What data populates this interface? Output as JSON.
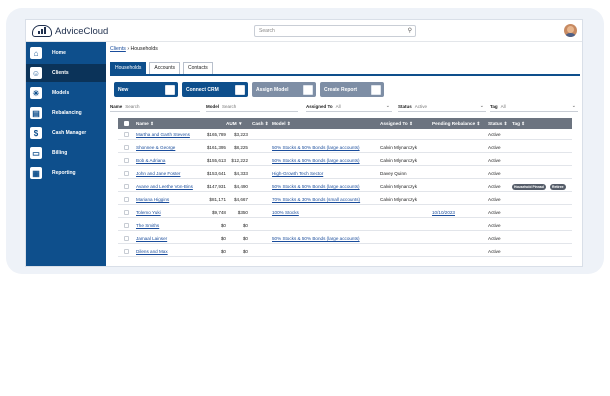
{
  "app": {
    "logo_text": "AdviceCloud"
  },
  "search": {
    "placeholder": "Search"
  },
  "sidebar": {
    "items": [
      {
        "label": "Home",
        "icon": "home-icon",
        "glyph": "⌂",
        "active": false
      },
      {
        "label": "Clients",
        "icon": "user-icon",
        "glyph": "☺",
        "active": true
      },
      {
        "label": "Models",
        "icon": "asterisk-icon",
        "glyph": "✳",
        "active": false
      },
      {
        "label": "Rebalancing",
        "icon": "document-icon",
        "glyph": "▤",
        "active": false
      },
      {
        "label": "Cash Manager",
        "icon": "dollar-icon",
        "glyph": "$",
        "active": false
      },
      {
        "label": "Billing",
        "icon": "credit-card-icon",
        "glyph": "▭",
        "active": false
      },
      {
        "label": "Reporting",
        "icon": "grid-icon",
        "glyph": "▦",
        "active": false
      }
    ]
  },
  "breadcrumb": {
    "root": "Clients",
    "sep": "›",
    "current": "Households"
  },
  "tabs": [
    "Households",
    "Accounts",
    "Contacts"
  ],
  "buttons": {
    "new": "New",
    "connect_crm": "Connect CRM",
    "assign_model": "Assign Model",
    "create_report": "Create Report"
  },
  "filters": {
    "name": {
      "label": "Name",
      "placeholder": "Search"
    },
    "model": {
      "label": "Model",
      "placeholder": "Search"
    },
    "assigned_to": {
      "label": "Assigned To",
      "value": "All"
    },
    "status": {
      "label": "Status",
      "value": "Active"
    },
    "tag": {
      "label": "Tag",
      "value": "All"
    }
  },
  "table": {
    "columns": {
      "name": "Name ⇕",
      "aum": "AUM ▼",
      "cash": "Cash ⇕",
      "model": "Model ⇕",
      "assigned_to": "Assigned To ⇕",
      "pending_rebalance": "Pending Rebalance ⇕",
      "status": "Status ⇕",
      "tag": "Tag ⇕"
    },
    "rows": [
      {
        "name": "Martha and Garth Stevens",
        "aum": "$165,789",
        "cash": "$3,223",
        "model": "",
        "assigned_to": "",
        "pending": "",
        "status": "Active",
        "tags": []
      },
      {
        "name": "Shonnee & George",
        "aum": "$161,395",
        "cash": "$8,225",
        "model": "50% Stocks & 50% Bonds (large accounts)",
        "assigned_to": "Calvin Mlynarczyk",
        "pending": "",
        "status": "Active",
        "tags": []
      },
      {
        "name": "Bob & Adriana",
        "aum": "$155,613",
        "cash": "$12,222",
        "model": "50% Stocks & 50% Bonds (large accounts)",
        "assigned_to": "Calvin Mlynarczyk",
        "pending": "",
        "status": "Active",
        "tags": []
      },
      {
        "name": "John and Jane Foster",
        "aum": "$153,641",
        "cash": "$4,333",
        "model": "High-Growth Tech Sector",
        "assigned_to": "Davey Quinn",
        "pending": "",
        "status": "Active",
        "tags": []
      },
      {
        "name": "Avane and Leethe Von-Bins",
        "aum": "$147,931",
        "cash": "$4,490",
        "model": "50% Stocks & 50% Bonds (large accounts)",
        "assigned_to": "Calvin Mlynarczyk",
        "pending": "",
        "status": "Active",
        "tags": [
          "Household Pinnad",
          "Retiree"
        ]
      },
      {
        "name": "Mariana Higgins",
        "aum": "$81,171",
        "cash": "$4,667",
        "model": "70% Stocks & 30% Bonds (small accounts)",
        "assigned_to": "Calvin Mlynarczyk",
        "pending": "",
        "status": "Active",
        "tags": []
      },
      {
        "name": "Tolemo Yuki",
        "aum": "$9,748",
        "cash": "$350",
        "model": "100% Stocks",
        "assigned_to": "",
        "pending": "10/10/2023",
        "status": "Active",
        "tags": []
      },
      {
        "name": "The Smiths",
        "aum": "$0",
        "cash": "$0",
        "model": "",
        "assigned_to": "",
        "pending": "",
        "status": "Active",
        "tags": []
      },
      {
        "name": "Jamaal Lainser",
        "aum": "$0",
        "cash": "$0",
        "model": "50% Stocks & 50% Bonds (large accounts)",
        "assigned_to": "",
        "pending": "",
        "status": "Active",
        "tags": []
      },
      {
        "name": "Dilens and Max",
        "aum": "$0",
        "cash": "$0",
        "model": "",
        "assigned_to": "",
        "pending": "",
        "status": "Active",
        "tags": []
      }
    ]
  },
  "colors": {
    "brand": "#0e4f8c",
    "sidebar_active": "#0b3359",
    "header": "#6c7480",
    "button_gray": "#7e8ea5",
    "link": "#1a4d9c"
  }
}
